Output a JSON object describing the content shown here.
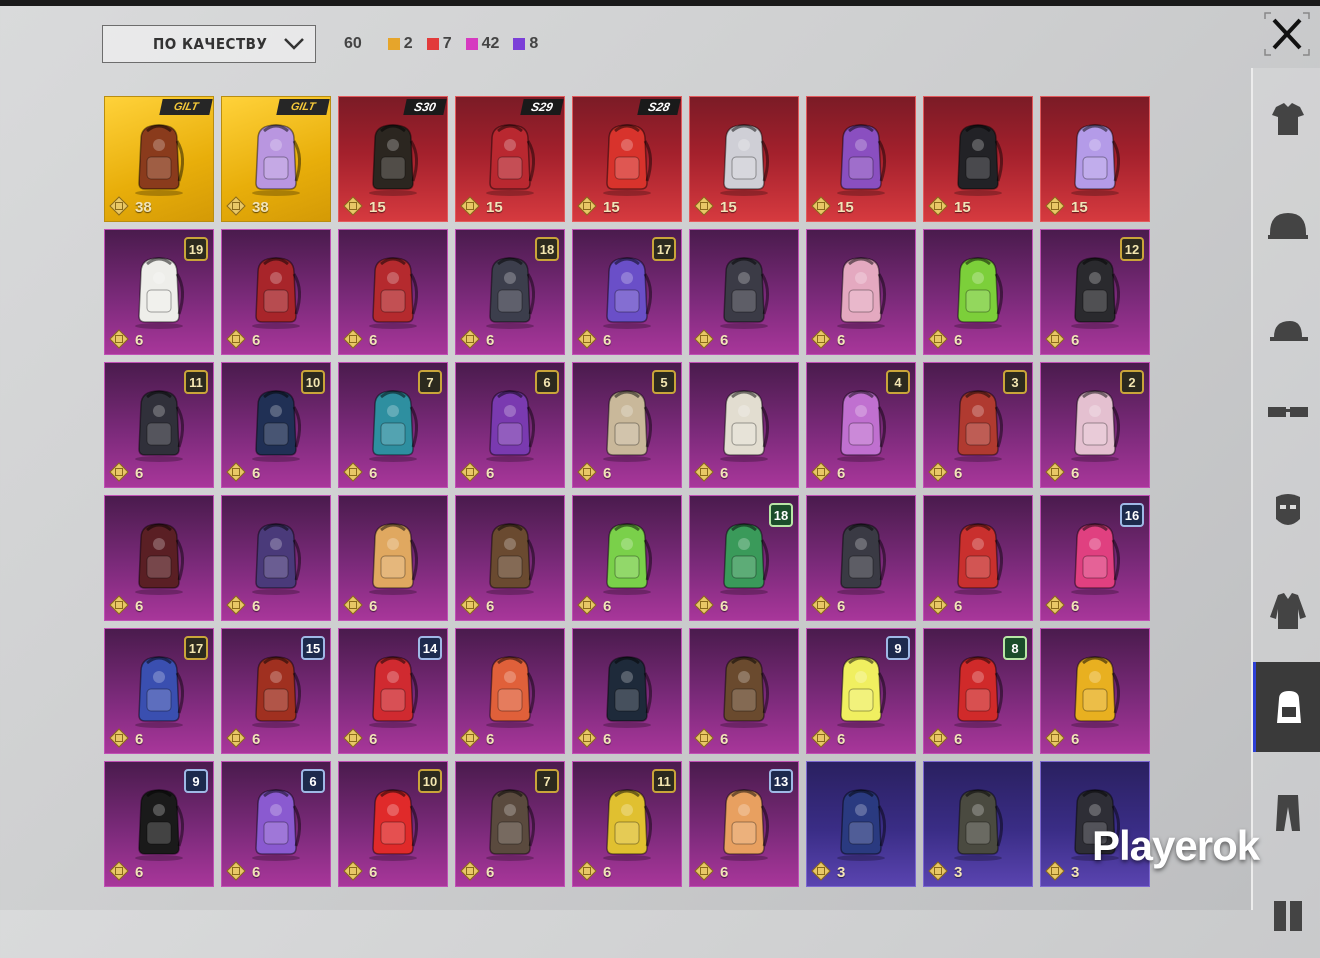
{
  "sort": {
    "label": "ПО КАЧЕСТВУ"
  },
  "counts": {
    "total": "60",
    "items": [
      {
        "color": "#e6a52b",
        "value": "2"
      },
      {
        "color": "#e23b3b",
        "value": "7"
      },
      {
        "color": "#d63ac0",
        "value": "42"
      },
      {
        "color": "#7b3fd8",
        "value": "8"
      }
    ]
  },
  "watermark": "Playerok",
  "nav": [
    "shirt-icon",
    "helmet-icon",
    "cap-icon",
    "glasses-icon",
    "mask-icon",
    "jacket-icon",
    "backpack-icon",
    "pants-icon",
    "shoes-icon"
  ],
  "tiles": [
    {
      "rarity": "gold",
      "tag": "GILT",
      "price": "38",
      "color": "#8a3b1c"
    },
    {
      "rarity": "gold",
      "tag": "GILT",
      "price": "38",
      "color": "#b996e0"
    },
    {
      "rarity": "red",
      "tag": "S30",
      "price": "15",
      "color": "#2b2620"
    },
    {
      "rarity": "red",
      "tag": "S29",
      "price": "15",
      "color": "#b92830"
    },
    {
      "rarity": "red",
      "tag": "S28",
      "price": "15",
      "color": "#d8332c"
    },
    {
      "rarity": "red",
      "price": "15",
      "color": "#cfcfd6"
    },
    {
      "rarity": "red",
      "price": "15",
      "color": "#8a4fc0"
    },
    {
      "rarity": "red",
      "price": "15",
      "color": "#222226"
    },
    {
      "rarity": "red",
      "price": "15",
      "color": "#b49be8"
    },
    {
      "rarity": "pink",
      "level": "19",
      "price": "6",
      "color": "#eeeeea"
    },
    {
      "rarity": "pink",
      "price": "6",
      "color": "#a8252a"
    },
    {
      "rarity": "pink",
      "price": "6",
      "color": "#b52a2e"
    },
    {
      "rarity": "pink",
      "level": "18",
      "price": "6",
      "color": "#3c3e4c"
    },
    {
      "rarity": "pink",
      "level": "17",
      "price": "6",
      "color": "#6a4fc8"
    },
    {
      "rarity": "pink",
      "price": "6",
      "color": "#3b3b46"
    },
    {
      "rarity": "pink",
      "price": "6",
      "color": "#e4a9c0"
    },
    {
      "rarity": "pink",
      "price": "6",
      "color": "#7ccf3a"
    },
    {
      "rarity": "pink",
      "level": "12",
      "price": "6",
      "color": "#2a2a2e"
    },
    {
      "rarity": "pink",
      "level": "11",
      "price": "6",
      "color": "#30303a"
    },
    {
      "rarity": "pink",
      "level": "10",
      "price": "6",
      "color": "#203055"
    },
    {
      "rarity": "pink",
      "level": "7",
      "price": "6",
      "color": "#2e8fa0"
    },
    {
      "rarity": "pink",
      "level": "6",
      "price": "6",
      "color": "#7a3ab0"
    },
    {
      "rarity": "pink",
      "level": "5",
      "price": "6",
      "color": "#c9b89a"
    },
    {
      "rarity": "pink",
      "price": "6",
      "color": "#e2ddd0"
    },
    {
      "rarity": "pink",
      "level": "4",
      "price": "6",
      "color": "#c070d0"
    },
    {
      "rarity": "pink",
      "level": "3",
      "price": "6",
      "color": "#b03a30"
    },
    {
      "rarity": "pink",
      "level": "2",
      "price": "6",
      "color": "#e4c0d0"
    },
    {
      "rarity": "pink",
      "price": "6",
      "color": "#5a1f24"
    },
    {
      "rarity": "pink",
      "price": "6",
      "color": "#4a3a7a"
    },
    {
      "rarity": "pink",
      "price": "6",
      "color": "#e0a860"
    },
    {
      "rarity": "pink",
      "price": "6",
      "color": "#6a4a30"
    },
    {
      "rarity": "pink",
      "price": "6",
      "color": "#7ad04a"
    },
    {
      "rarity": "pink",
      "level": "18",
      "levelStyle": "green",
      "price": "6",
      "color": "#3a9a5a"
    },
    {
      "rarity": "pink",
      "price": "6",
      "color": "#3a3a44"
    },
    {
      "rarity": "pink",
      "price": "6",
      "color": "#c9302e"
    },
    {
      "rarity": "pink",
      "level": "16",
      "levelStyle": "blue",
      "price": "6",
      "color": "#e04080"
    },
    {
      "rarity": "pink",
      "level": "17",
      "price": "6",
      "color": "#3a4fb0"
    },
    {
      "rarity": "pink",
      "level": "15",
      "levelStyle": "blue",
      "price": "6",
      "color": "#a03020"
    },
    {
      "rarity": "pink",
      "level": "14",
      "levelStyle": "blue",
      "price": "6",
      "color": "#d02a30"
    },
    {
      "rarity": "pink",
      "price": "6",
      "color": "#e0603a"
    },
    {
      "rarity": "pink",
      "price": "6",
      "color": "#1e2a3a"
    },
    {
      "rarity": "pink",
      "price": "6",
      "color": "#6a4a2e"
    },
    {
      "rarity": "pink",
      "level": "9",
      "levelStyle": "blue",
      "price": "6",
      "color": "#f0ef60"
    },
    {
      "rarity": "pink",
      "level": "8",
      "levelStyle": "green",
      "price": "6",
      "color": "#d02a2a"
    },
    {
      "rarity": "pink",
      "price": "6",
      "color": "#e8b020"
    },
    {
      "rarity": "pink",
      "level": "9",
      "levelStyle": "blue",
      "price": "6",
      "color": "#1a1a1a"
    },
    {
      "rarity": "pink",
      "level": "6",
      "levelStyle": "blue",
      "price": "6",
      "color": "#8a5ad0"
    },
    {
      "rarity": "pink",
      "level": "10",
      "price": "6",
      "color": "#e02a2a"
    },
    {
      "rarity": "pink",
      "level": "7",
      "price": "6",
      "color": "#5a4a3e"
    },
    {
      "rarity": "pink",
      "level": "11",
      "price": "6",
      "color": "#e0c030"
    },
    {
      "rarity": "pink",
      "level": "13",
      "levelStyle": "blue",
      "price": "6",
      "color": "#e8a060"
    },
    {
      "rarity": "blue",
      "price": "3",
      "color": "#2a3a80"
    },
    {
      "rarity": "blue",
      "price": "3",
      "color": "#4a4a40"
    },
    {
      "rarity": "blue",
      "price": "3",
      "color": "#2e2e36"
    }
  ]
}
